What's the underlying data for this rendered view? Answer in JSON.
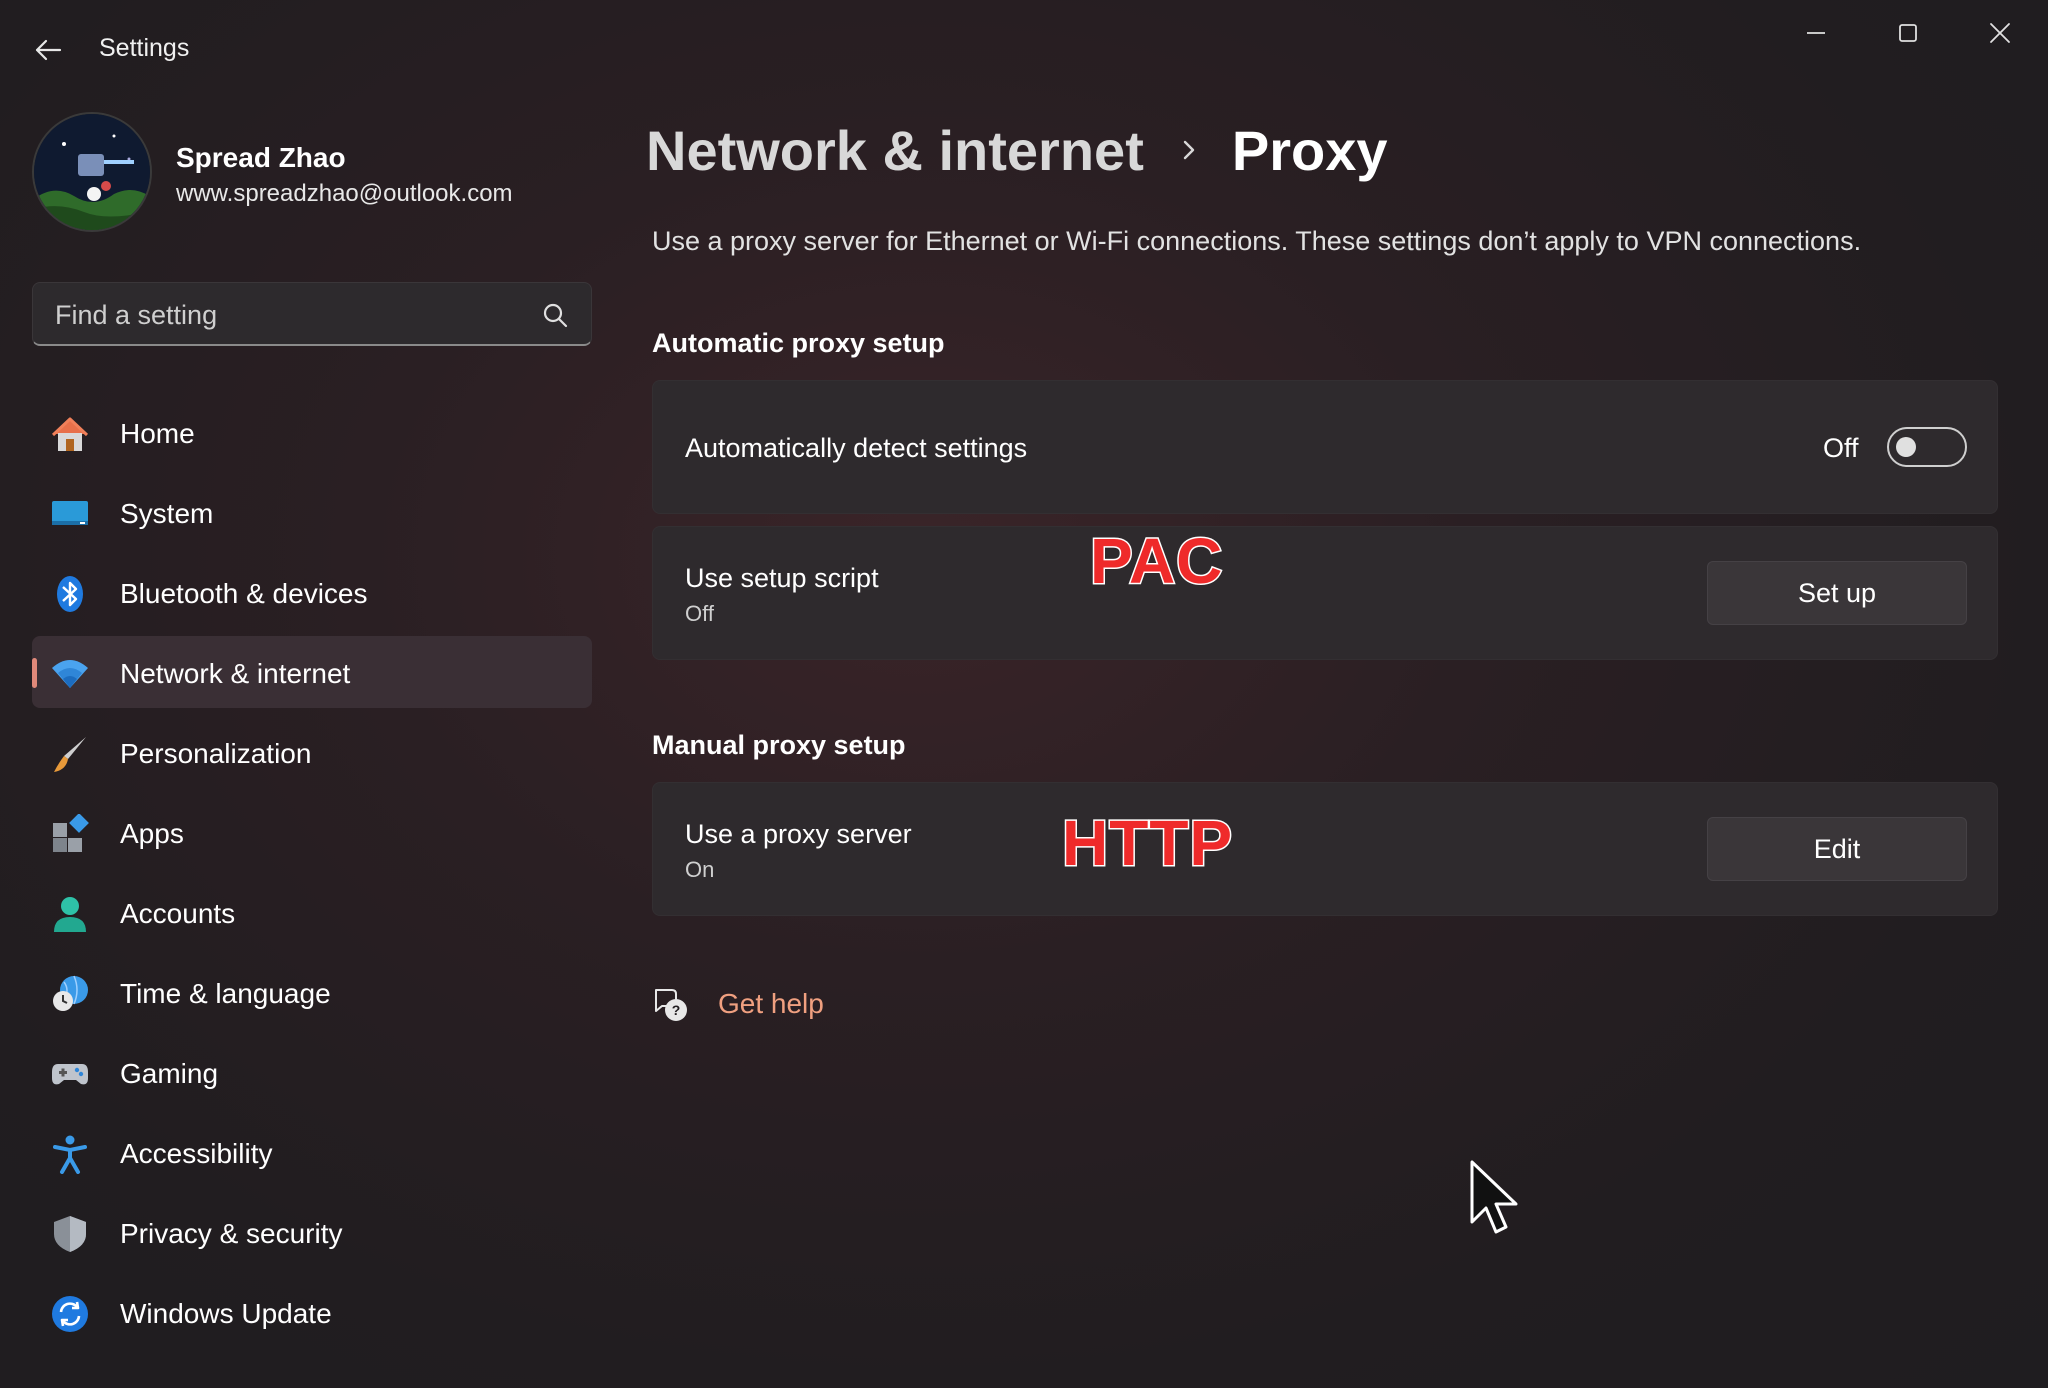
{
  "window": {
    "title": "Settings"
  },
  "profile": {
    "name": "Spread Zhao",
    "email": "www.spreadzhao@outlook.com"
  },
  "search": {
    "placeholder": "Find a setting"
  },
  "sidebar": {
    "items": [
      {
        "label": "Home",
        "icon": "home-icon"
      },
      {
        "label": "System",
        "icon": "monitor-icon"
      },
      {
        "label": "Bluetooth & devices",
        "icon": "bluetooth-icon"
      },
      {
        "label": "Network & internet",
        "icon": "wifi-icon",
        "active": true
      },
      {
        "label": "Personalization",
        "icon": "paintbrush-icon"
      },
      {
        "label": "Apps",
        "icon": "apps-icon"
      },
      {
        "label": "Accounts",
        "icon": "person-icon"
      },
      {
        "label": "Time & language",
        "icon": "globe-clock-icon"
      },
      {
        "label": "Gaming",
        "icon": "gamepad-icon"
      },
      {
        "label": "Accessibility",
        "icon": "accessibility-icon"
      },
      {
        "label": "Privacy & security",
        "icon": "shield-icon"
      },
      {
        "label": "Windows Update",
        "icon": "update-icon"
      }
    ]
  },
  "main": {
    "breadcrumb_parent": "Network & internet",
    "breadcrumb_current": "Proxy",
    "description": "Use a proxy server for Ethernet or Wi-Fi connections. These settings don’t apply to VPN connections.",
    "automatic": {
      "heading": "Automatic proxy setup",
      "detect": {
        "label": "Automatically detect settings",
        "state_label": "Off",
        "enabled": false
      },
      "script": {
        "label": "Use setup script",
        "status": "Off",
        "button": "Set up"
      }
    },
    "manual": {
      "heading": "Manual proxy setup",
      "proxy": {
        "label": "Use a proxy server",
        "status": "On",
        "button": "Edit"
      }
    },
    "help_link": "Get help"
  },
  "annotations": {
    "pac": "PAC",
    "http": "HTTP"
  },
  "colors": {
    "accent": "#e0897a",
    "link": "#f0a080",
    "overlay_text": "#ef2a2a"
  }
}
